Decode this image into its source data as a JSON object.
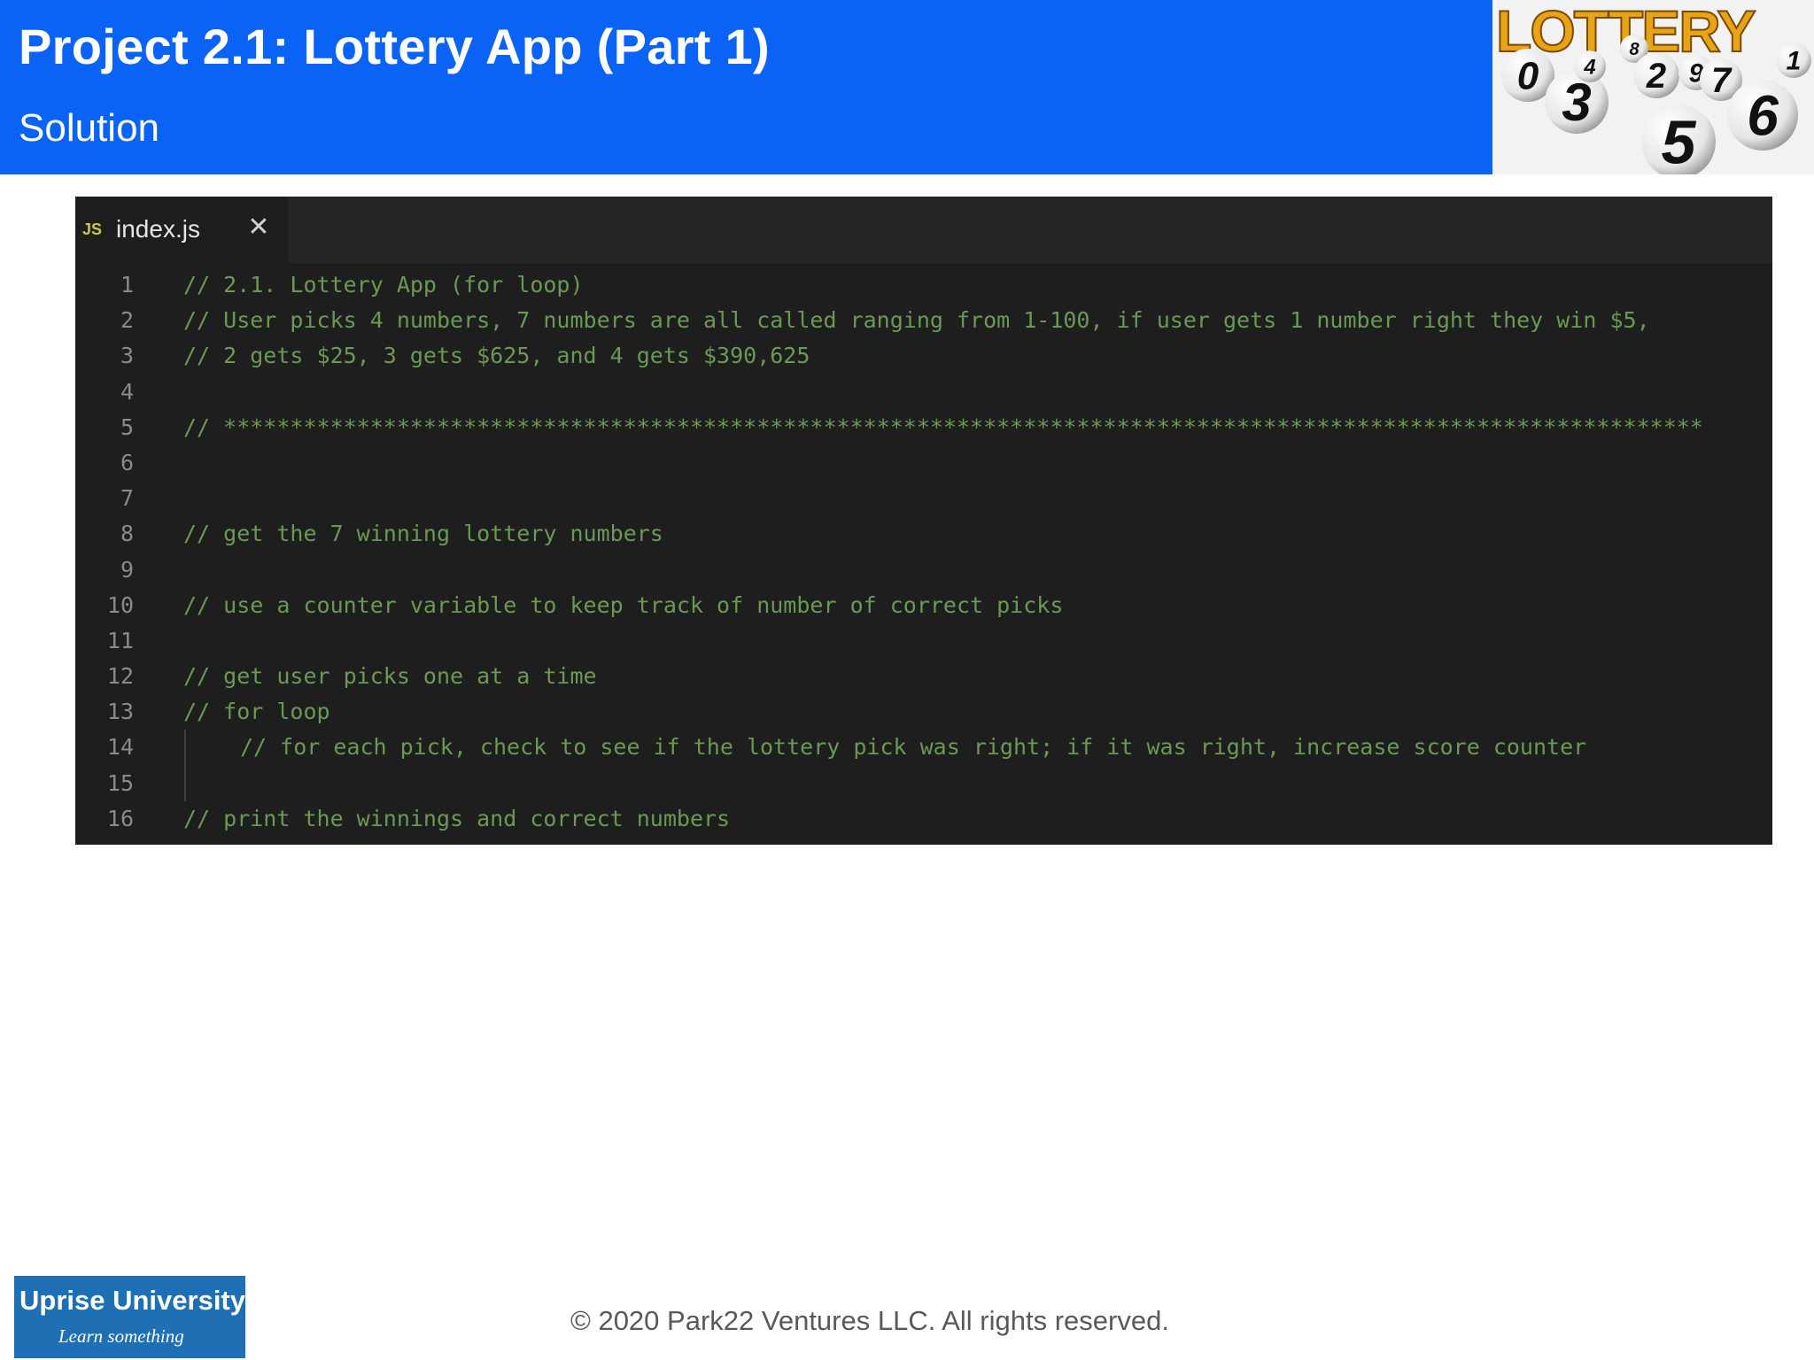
{
  "header": {
    "title": "Project 2.1: Lottery App (Part 1)",
    "subtitle": "Solution"
  },
  "lottery_logo": {
    "word": "LOTTERY",
    "ball_numbers": [
      "0",
      "3",
      "4",
      "8",
      "2",
      "9",
      "7",
      "1",
      "5",
      "6"
    ]
  },
  "editor": {
    "tab": {
      "badge": "JS",
      "filename": "index.js",
      "close_glyph": "✕"
    },
    "lines": [
      {
        "n": "1",
        "text": "// 2.1. Lottery App (for loop)"
      },
      {
        "n": "2",
        "text": "// User picks 4 numbers, 7 numbers are all called ranging from 1-100, if user gets 1 number right they win $5,"
      },
      {
        "n": "3",
        "text": "// 2 gets $25, 3 gets $625, and 4 gets $390,625"
      },
      {
        "n": "4",
        "text": ""
      },
      {
        "n": "5",
        "text": "// ***************************************************************************************************************"
      },
      {
        "n": "6",
        "text": ""
      },
      {
        "n": "7",
        "text": ""
      },
      {
        "n": "8",
        "text": "// get the 7 winning lottery numbers"
      },
      {
        "n": "9",
        "text": ""
      },
      {
        "n": "10",
        "text": "// use a counter variable to keep track of number of correct picks"
      },
      {
        "n": "11",
        "text": ""
      },
      {
        "n": "12",
        "text": "// get user picks one at a time"
      },
      {
        "n": "13",
        "text": "// for loop"
      },
      {
        "n": "14",
        "text": "// for each pick, check to see if the lottery pick was right; if it was right, increase score counter"
      },
      {
        "n": "15",
        "text": ""
      },
      {
        "n": "16",
        "text": "// print the winnings and correct numbers"
      }
    ],
    "colors": {
      "comment": "#6a9955",
      "line_number": "#8a8a8a",
      "background": "#1e1e1e"
    }
  },
  "footer": {
    "brand": "Uprise University",
    "tagline": "Learn something",
    "copyright": "© 2020 Park22 Ventures LLC. All rights reserved."
  },
  "colors": {
    "header_blue": "#0a63f5",
    "brand_blue": "#1f6fb4"
  }
}
